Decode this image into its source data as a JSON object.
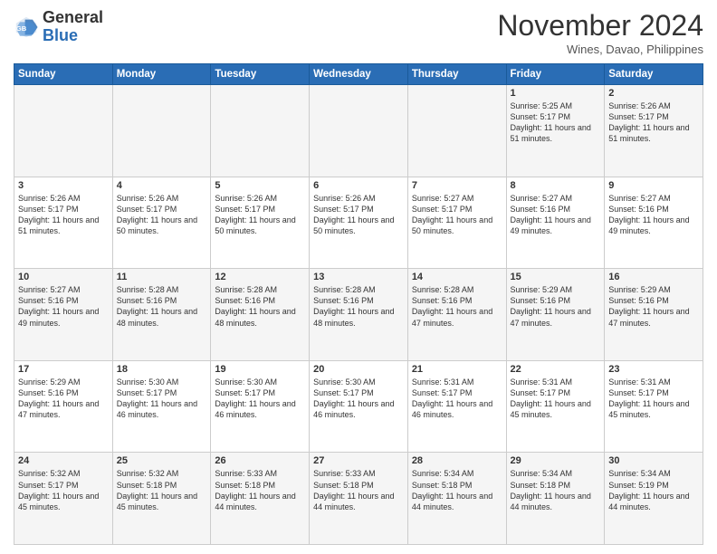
{
  "header": {
    "logo_general": "General",
    "logo_blue": "Blue",
    "month_title": "November 2024",
    "location": "Wines, Davao, Philippines"
  },
  "days_of_week": [
    "Sunday",
    "Monday",
    "Tuesday",
    "Wednesday",
    "Thursday",
    "Friday",
    "Saturday"
  ],
  "weeks": [
    [
      {
        "day": "",
        "info": ""
      },
      {
        "day": "",
        "info": ""
      },
      {
        "day": "",
        "info": ""
      },
      {
        "day": "",
        "info": ""
      },
      {
        "day": "",
        "info": ""
      },
      {
        "day": "1",
        "info": "Sunrise: 5:25 AM\nSunset: 5:17 PM\nDaylight: 11 hours and 51 minutes."
      },
      {
        "day": "2",
        "info": "Sunrise: 5:26 AM\nSunset: 5:17 PM\nDaylight: 11 hours and 51 minutes."
      }
    ],
    [
      {
        "day": "3",
        "info": "Sunrise: 5:26 AM\nSunset: 5:17 PM\nDaylight: 11 hours and 51 minutes."
      },
      {
        "day": "4",
        "info": "Sunrise: 5:26 AM\nSunset: 5:17 PM\nDaylight: 11 hours and 50 minutes."
      },
      {
        "day": "5",
        "info": "Sunrise: 5:26 AM\nSunset: 5:17 PM\nDaylight: 11 hours and 50 minutes."
      },
      {
        "day": "6",
        "info": "Sunrise: 5:26 AM\nSunset: 5:17 PM\nDaylight: 11 hours and 50 minutes."
      },
      {
        "day": "7",
        "info": "Sunrise: 5:27 AM\nSunset: 5:17 PM\nDaylight: 11 hours and 50 minutes."
      },
      {
        "day": "8",
        "info": "Sunrise: 5:27 AM\nSunset: 5:16 PM\nDaylight: 11 hours and 49 minutes."
      },
      {
        "day": "9",
        "info": "Sunrise: 5:27 AM\nSunset: 5:16 PM\nDaylight: 11 hours and 49 minutes."
      }
    ],
    [
      {
        "day": "10",
        "info": "Sunrise: 5:27 AM\nSunset: 5:16 PM\nDaylight: 11 hours and 49 minutes."
      },
      {
        "day": "11",
        "info": "Sunrise: 5:28 AM\nSunset: 5:16 PM\nDaylight: 11 hours and 48 minutes."
      },
      {
        "day": "12",
        "info": "Sunrise: 5:28 AM\nSunset: 5:16 PM\nDaylight: 11 hours and 48 minutes."
      },
      {
        "day": "13",
        "info": "Sunrise: 5:28 AM\nSunset: 5:16 PM\nDaylight: 11 hours and 48 minutes."
      },
      {
        "day": "14",
        "info": "Sunrise: 5:28 AM\nSunset: 5:16 PM\nDaylight: 11 hours and 47 minutes."
      },
      {
        "day": "15",
        "info": "Sunrise: 5:29 AM\nSunset: 5:16 PM\nDaylight: 11 hours and 47 minutes."
      },
      {
        "day": "16",
        "info": "Sunrise: 5:29 AM\nSunset: 5:16 PM\nDaylight: 11 hours and 47 minutes."
      }
    ],
    [
      {
        "day": "17",
        "info": "Sunrise: 5:29 AM\nSunset: 5:16 PM\nDaylight: 11 hours and 47 minutes."
      },
      {
        "day": "18",
        "info": "Sunrise: 5:30 AM\nSunset: 5:17 PM\nDaylight: 11 hours and 46 minutes."
      },
      {
        "day": "19",
        "info": "Sunrise: 5:30 AM\nSunset: 5:17 PM\nDaylight: 11 hours and 46 minutes."
      },
      {
        "day": "20",
        "info": "Sunrise: 5:30 AM\nSunset: 5:17 PM\nDaylight: 11 hours and 46 minutes."
      },
      {
        "day": "21",
        "info": "Sunrise: 5:31 AM\nSunset: 5:17 PM\nDaylight: 11 hours and 46 minutes."
      },
      {
        "day": "22",
        "info": "Sunrise: 5:31 AM\nSunset: 5:17 PM\nDaylight: 11 hours and 45 minutes."
      },
      {
        "day": "23",
        "info": "Sunrise: 5:31 AM\nSunset: 5:17 PM\nDaylight: 11 hours and 45 minutes."
      }
    ],
    [
      {
        "day": "24",
        "info": "Sunrise: 5:32 AM\nSunset: 5:17 PM\nDaylight: 11 hours and 45 minutes."
      },
      {
        "day": "25",
        "info": "Sunrise: 5:32 AM\nSunset: 5:18 PM\nDaylight: 11 hours and 45 minutes."
      },
      {
        "day": "26",
        "info": "Sunrise: 5:33 AM\nSunset: 5:18 PM\nDaylight: 11 hours and 44 minutes."
      },
      {
        "day": "27",
        "info": "Sunrise: 5:33 AM\nSunset: 5:18 PM\nDaylight: 11 hours and 44 minutes."
      },
      {
        "day": "28",
        "info": "Sunrise: 5:34 AM\nSunset: 5:18 PM\nDaylight: 11 hours and 44 minutes."
      },
      {
        "day": "29",
        "info": "Sunrise: 5:34 AM\nSunset: 5:18 PM\nDaylight: 11 hours and 44 minutes."
      },
      {
        "day": "30",
        "info": "Sunrise: 5:34 AM\nSunset: 5:19 PM\nDaylight: 11 hours and 44 minutes."
      }
    ]
  ]
}
